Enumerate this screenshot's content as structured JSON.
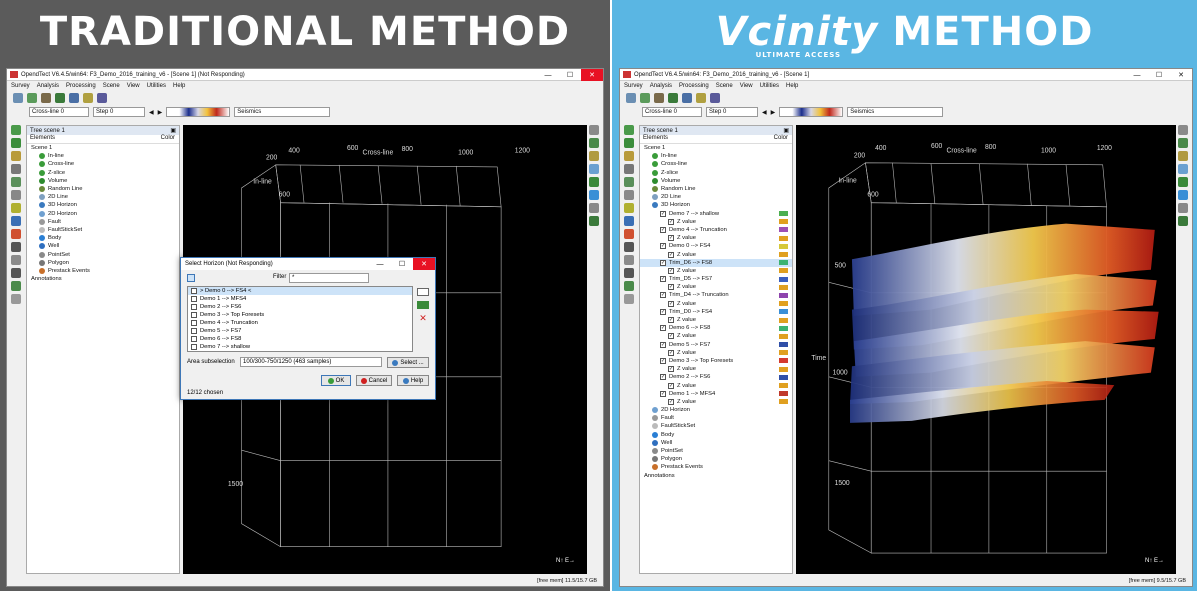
{
  "left": {
    "banner": "TRADITIONAL METHOD",
    "window_title": "OpendTect V6.4.5/win64: F3_Demo_2016_training_v6 - [Scene 1] (Not Responding)",
    "menus": [
      "Survey",
      "Analysis",
      "Processing",
      "Scene",
      "View",
      "Utilities",
      "Help"
    ],
    "crossline_field": "Cross-line 0",
    "step_field": "Step 0",
    "seismics_select": "Seismics",
    "tree_title": "Tree scene 1",
    "tree_col_elements": "Elements",
    "tree_col_color": "Color",
    "tree_items": [
      "Scene 1",
      "In-line",
      "Cross-line",
      "Z-slice",
      "Volume",
      "Random Line",
      "2D Line",
      "3D Horizon",
      "2D Horizon",
      "Fault",
      "FaultStickSet",
      "Body",
      "Well",
      "PointSet",
      "Polygon",
      "Prestack Events",
      "Annotations"
    ],
    "axis_labels": {
      "crossline": "Cross-line",
      "inline": "In-line",
      "x200": "200",
      "x400": "400",
      "x600": "600",
      "x800": "800",
      "x1000": "1000",
      "x1200": "1200",
      "y600": "600",
      "z1500": "1500"
    },
    "status": "[free mem] 11.5/15.7 GB",
    "dialog": {
      "title": "Select Horizon (Not Responding)",
      "filter_label": "Filter",
      "filter_value": "*",
      "items": [
        "> Demo 0 --> FS4 <",
        "Demo 1 --> MFS4",
        "Demo 2 --> FS6",
        "Demo 3 --> Top Foresets",
        "Demo 4 --> Truncation",
        "Demo 5 --> FS7",
        "Demo 6 --> FS8",
        "Demo 7 --> shallow"
      ],
      "area_label": "Area subselection",
      "area_value": "100/300-750/1250 (463 samples)",
      "select_btn": "Select ...",
      "ok_btn": "OK",
      "cancel_btn": "Cancel",
      "help_btn": "Help",
      "chosen": "12/12 chosen"
    }
  },
  "right": {
    "banner_brand": "Vcinity",
    "banner_tagline": "ULTIMATE ACCESS",
    "banner_rest": "METHOD",
    "window_title": "OpendTect V6.4.5/win64: F3_Demo_2016_training_v6 - [Scene 1]",
    "menus": [
      "Survey",
      "Analysis",
      "Processing",
      "Scene",
      "View",
      "Utilities",
      "Help"
    ],
    "crossline_field": "Cross-line 0",
    "step_field": "Step 0",
    "seismics_select": "Seismics",
    "tree_title": "Tree scene 1",
    "tree_col_elements": "Elements",
    "tree_col_color": "Color",
    "tree_items": [
      {
        "label": "Scene 1",
        "indent": 0,
        "type": "plain"
      },
      {
        "label": "In-line",
        "indent": 1,
        "type": "dot",
        "color": "#3a9c3a"
      },
      {
        "label": "Cross-line",
        "indent": 1,
        "type": "dot",
        "color": "#3a9c3a"
      },
      {
        "label": "Z-slice",
        "indent": 1,
        "type": "dot",
        "color": "#3a9c3a"
      },
      {
        "label": "Volume",
        "indent": 1,
        "type": "dot",
        "color": "#2e8b2e"
      },
      {
        "label": "Random Line",
        "indent": 1,
        "type": "dot",
        "color": "#6a8a3a"
      },
      {
        "label": "2D Line",
        "indent": 1,
        "type": "dot",
        "color": "#7fa0c0"
      },
      {
        "label": "3D Horizon",
        "indent": 1,
        "type": "dot",
        "color": "#3a7abf"
      },
      {
        "label": "Demo 7 --> shallow",
        "indent": 2,
        "type": "chk",
        "swatch": "#4caf50"
      },
      {
        "label": "Z value",
        "indent": 3,
        "type": "chk",
        "swatch": "#e0a020"
      },
      {
        "label": "Demo 4 --> Truncation",
        "indent": 2,
        "type": "chk",
        "swatch": "#9c4fb5"
      },
      {
        "label": "Z value",
        "indent": 3,
        "type": "chk",
        "swatch": "#e0a020"
      },
      {
        "label": "Demo 0 --> FS4",
        "indent": 2,
        "type": "chk",
        "swatch": "#d6c93a"
      },
      {
        "label": "Z value",
        "indent": 3,
        "type": "chk",
        "swatch": "#e0a020"
      },
      {
        "label": "Trim_D6 --> FS8",
        "indent": 2,
        "type": "chk",
        "swatch": "#3cb371",
        "selected": true
      },
      {
        "label": "Z value",
        "indent": 3,
        "type": "chk",
        "swatch": "#e0a020"
      },
      {
        "label": "Trim_D5 --> FS7",
        "indent": 2,
        "type": "chk",
        "swatch": "#3a5fbf"
      },
      {
        "label": "Z value",
        "indent": 3,
        "type": "chk",
        "swatch": "#e0a020"
      },
      {
        "label": "Trim_D4 --> Truncation",
        "indent": 2,
        "type": "chk",
        "swatch": "#8e44ad"
      },
      {
        "label": "Z value",
        "indent": 3,
        "type": "chk",
        "swatch": "#e0a020"
      },
      {
        "label": "Trim_D0 --> FS4",
        "indent": 2,
        "type": "chk",
        "swatch": "#3a8fd6"
      },
      {
        "label": "Z value",
        "indent": 3,
        "type": "chk",
        "swatch": "#e0a020"
      },
      {
        "label": "Demo 6 --> FS8",
        "indent": 2,
        "type": "chk",
        "swatch": "#3cb371"
      },
      {
        "label": "Z value",
        "indent": 3,
        "type": "chk",
        "swatch": "#e0a020"
      },
      {
        "label": "Demo 5 --> FS7",
        "indent": 2,
        "type": "chk",
        "swatch": "#2f4fa8"
      },
      {
        "label": "Z value",
        "indent": 3,
        "type": "chk",
        "swatch": "#e0a020"
      },
      {
        "label": "Demo 3 --> Top Foresets",
        "indent": 2,
        "type": "chk",
        "swatch": "#d43a2f"
      },
      {
        "label": "Z value",
        "indent": 3,
        "type": "chk",
        "swatch": "#e0a020"
      },
      {
        "label": "Demo 2 --> FS6",
        "indent": 2,
        "type": "chk",
        "swatch": "#2f4fa8"
      },
      {
        "label": "Z value",
        "indent": 3,
        "type": "chk",
        "swatch": "#e0a020"
      },
      {
        "label": "Demo 1 --> MFS4",
        "indent": 2,
        "type": "chk",
        "swatch": "#c0392b"
      },
      {
        "label": "Z value",
        "indent": 3,
        "type": "chk",
        "swatch": "#e0a020"
      },
      {
        "label": "2D Horizon",
        "indent": 1,
        "type": "dot",
        "color": "#6fa0d0"
      },
      {
        "label": "Fault",
        "indent": 1,
        "type": "dot",
        "color": "#999999"
      },
      {
        "label": "FaultStickSet",
        "indent": 1,
        "type": "dot",
        "color": "#bbbbbb"
      },
      {
        "label": "Body",
        "indent": 1,
        "type": "dot",
        "color": "#2a7fd4"
      },
      {
        "label": "Well",
        "indent": 1,
        "type": "dot",
        "color": "#2f6fbf"
      },
      {
        "label": "PointSet",
        "indent": 1,
        "type": "dot",
        "color": "#8a8a8a"
      },
      {
        "label": "Polygon",
        "indent": 1,
        "type": "dot",
        "color": "#777777"
      },
      {
        "label": "Prestack Events",
        "indent": 1,
        "type": "dot",
        "color": "#c8702a"
      },
      {
        "label": "Annotations",
        "indent": 0,
        "type": "plain"
      }
    ],
    "axis_labels": {
      "crossline": "Cross-line",
      "inline": "In-line",
      "time": "Time",
      "x200": "200",
      "x400": "400",
      "x600": "600",
      "x800": "800",
      "x1000": "1000",
      "x1200": "1200",
      "y600": "600",
      "z500": "500",
      "z1000": "1000",
      "z1500": "1500"
    },
    "status": "[free mem] 9.5/15.7 GB"
  },
  "colors": {
    "traditional_banner": "#5b5b5b",
    "vcinity_banner": "#5ab6e3",
    "scene_bg": "#000000"
  }
}
